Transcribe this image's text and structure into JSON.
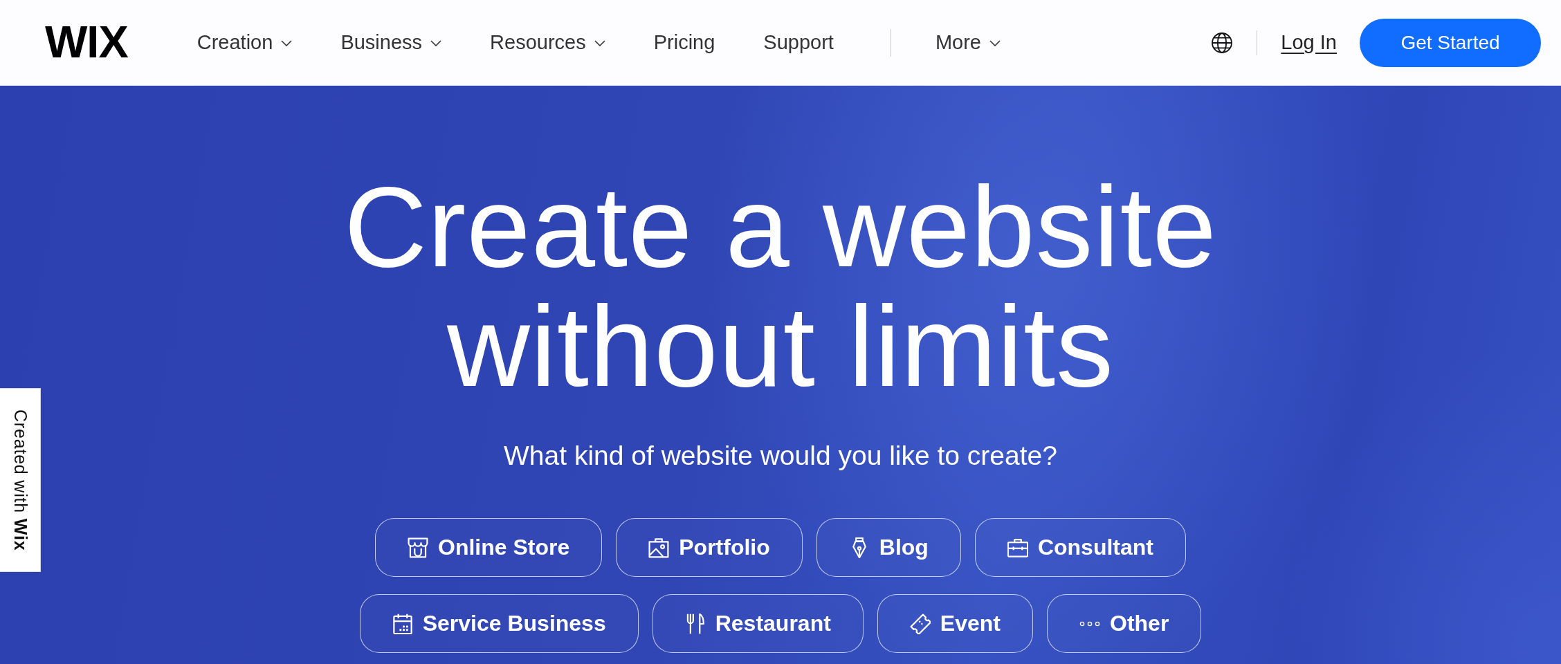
{
  "header": {
    "logo": "WIX",
    "nav_primary": [
      {
        "label": "Creation",
        "has_menu": true
      },
      {
        "label": "Business",
        "has_menu": true
      },
      {
        "label": "Resources",
        "has_menu": true
      },
      {
        "label": "Pricing",
        "has_menu": false
      },
      {
        "label": "Support",
        "has_menu": false
      }
    ],
    "nav_secondary": [
      {
        "label": "More",
        "has_menu": true
      }
    ],
    "login": "Log In",
    "cta": "Get Started"
  },
  "hero": {
    "title": "Create a website without limits",
    "subtitle": "What kind of website would you like to create?",
    "site_type_rows": [
      [
        {
          "label": "Online Store",
          "kind": "store"
        },
        {
          "label": "Portfolio",
          "kind": "portfolio"
        },
        {
          "label": "Blog",
          "kind": "blog"
        },
        {
          "label": "Consultant",
          "kind": "consultant"
        }
      ],
      [
        {
          "label": "Service Business",
          "kind": "service"
        },
        {
          "label": "Restaurant",
          "kind": "restaurant"
        },
        {
          "label": "Event",
          "kind": "event"
        },
        {
          "label": "Other",
          "kind": "other"
        }
      ]
    ]
  },
  "side_badge": {
    "text": "Created with **Wix**"
  }
}
